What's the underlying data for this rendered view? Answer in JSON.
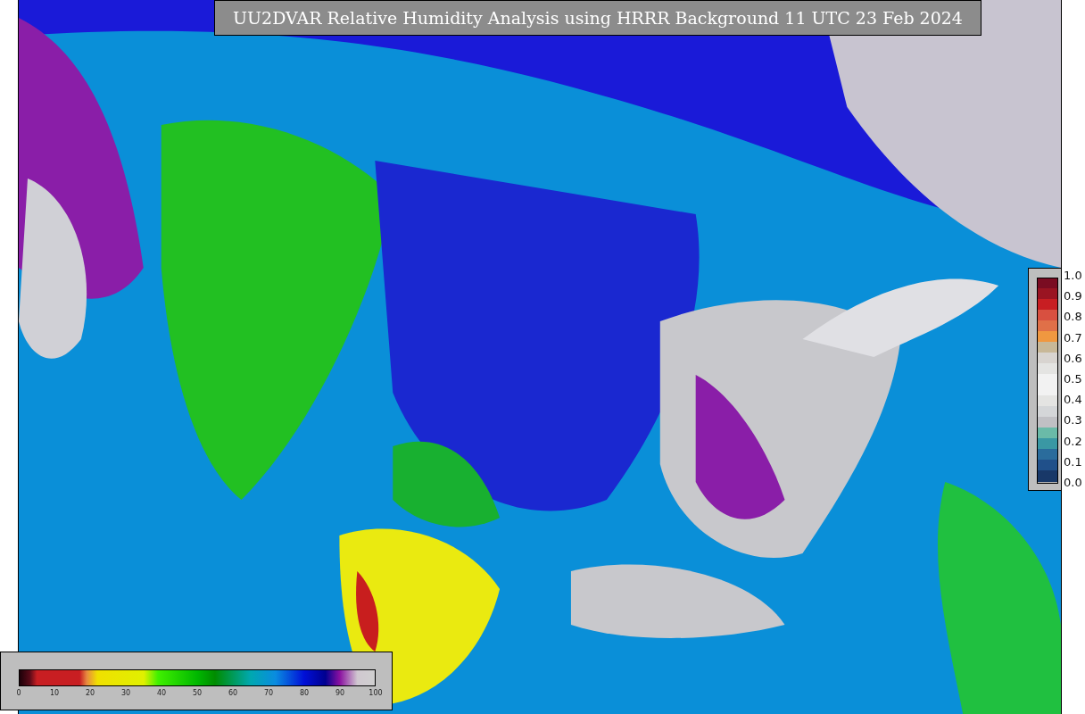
{
  "title": "UU2DVAR Relative Humidity Analysis using HRRR Background 11 UTC 23 Feb 2024",
  "humidity_legend": {
    "ticks": [
      "0",
      "10",
      "20",
      "30",
      "40",
      "50",
      "60",
      "70",
      "80",
      "90",
      "100"
    ]
  },
  "ratio_legend": {
    "ticks": [
      "1.0",
      "0.9",
      "0.8",
      "0.7",
      "0.6",
      "0.5",
      "0.4",
      "0.3",
      "0.2",
      "0.1",
      "0.0"
    ]
  }
}
